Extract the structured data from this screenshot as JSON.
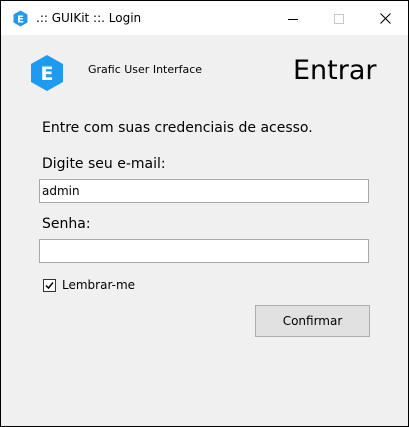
{
  "window": {
    "title": ".:: GUIKit ::. Login",
    "icon": "app-hexagon-e-icon",
    "controls": {
      "minimize_icon": "minimize-icon",
      "maximize_icon": "maximize-icon",
      "close_icon": "close-icon"
    }
  },
  "header": {
    "logo_letter": "E",
    "logo_icon": "app-hexagon-e-icon",
    "app_name": "Grafic User Interface",
    "page_title": "Entrar"
  },
  "form": {
    "instruction": "Entre com suas credenciais de acesso.",
    "email_label": "Digite seu e-mail:",
    "email_value": "admin",
    "password_label": "Senha:",
    "password_value": "",
    "remember_label": "Lembrar-me",
    "remember_checked": true,
    "confirm_label": "Confirmar"
  },
  "colors": {
    "accent": "#1e9bf0",
    "window_bg": "#f0f0f0",
    "titlebar_bg": "#ffffff",
    "button_bg": "#e1e1e1",
    "field_border": "#a8a8a8"
  }
}
